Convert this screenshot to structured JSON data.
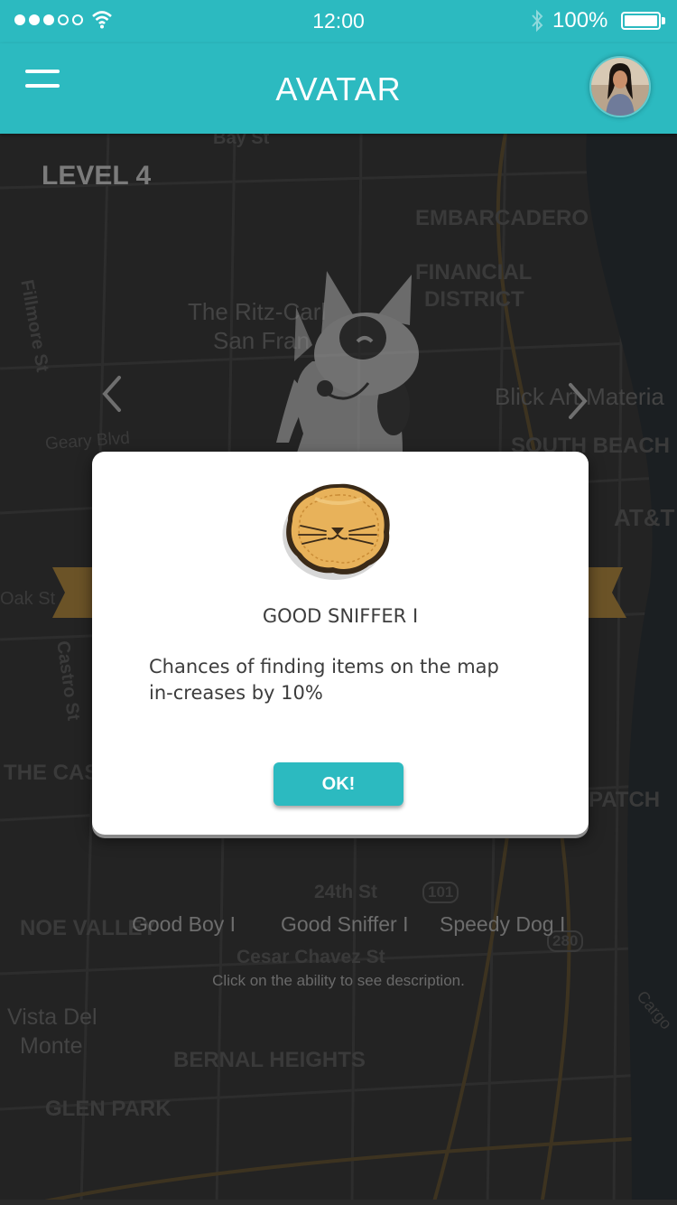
{
  "status_bar": {
    "time": "12:00",
    "battery": "100%"
  },
  "header": {
    "title": "AVATAR"
  },
  "map_labels": [
    "Bay St",
    "EMBARCADERO",
    "FINANCIAL",
    "DISTRICT",
    "The Ritz-Carl",
    "San Fran",
    "Fillmore St",
    "Geary Blvd",
    "Blick Art Materia",
    "SOUTH BEACH",
    "AT&T",
    "Oak St",
    "Castro St",
    "THE CAS",
    "PATCH",
    "24th St",
    "NOE VALLEY",
    "Cesar Chavez St",
    "Vista Del",
    "Monte",
    "BERNAL HEIGHTS",
    "GLEN PARK",
    "101",
    "280",
    "Cargo"
  ],
  "level": "LEVEL 4",
  "abilities": [
    "Good Boy I",
    "Good Sniffer I",
    "Speedy Dog I"
  ],
  "hint": "Click on the ability to see description.",
  "modal": {
    "title": "GOOD SNIFFER I",
    "description": "Chances of finding items on the map in-creases by 10%",
    "button": "OK!"
  },
  "colors": {
    "accent": "#2cbac0",
    "badge": "#e8b25a",
    "ribbon": "#b58a3c"
  }
}
